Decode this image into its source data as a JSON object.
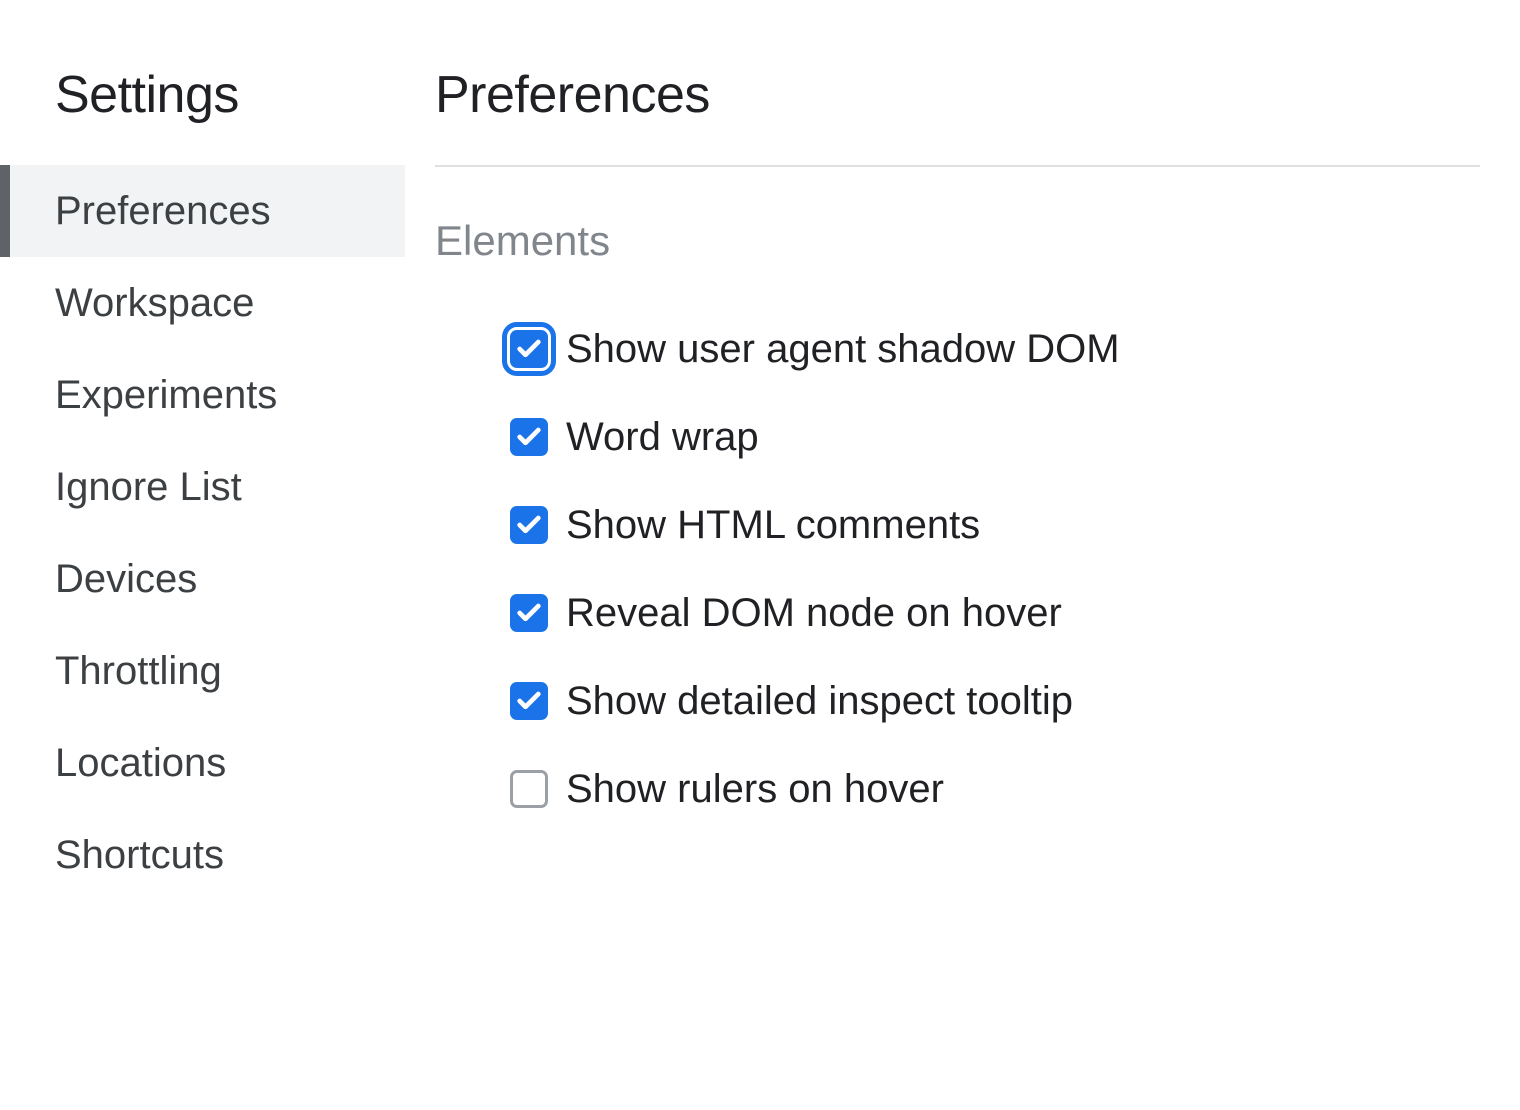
{
  "sidebar": {
    "title": "Settings",
    "items": [
      {
        "label": "Preferences",
        "active": true
      },
      {
        "label": "Workspace",
        "active": false
      },
      {
        "label": "Experiments",
        "active": false
      },
      {
        "label": "Ignore List",
        "active": false
      },
      {
        "label": "Devices",
        "active": false
      },
      {
        "label": "Throttling",
        "active": false
      },
      {
        "label": "Locations",
        "active": false
      },
      {
        "label": "Shortcuts",
        "active": false
      }
    ]
  },
  "main": {
    "title": "Preferences",
    "section": {
      "title": "Elements",
      "options": [
        {
          "label": "Show user agent shadow DOM",
          "checked": true,
          "focused": true
        },
        {
          "label": "Word wrap",
          "checked": true,
          "focused": false
        },
        {
          "label": "Show HTML comments",
          "checked": true,
          "focused": false
        },
        {
          "label": "Reveal DOM node on hover",
          "checked": true,
          "focused": false
        },
        {
          "label": "Show detailed inspect tooltip",
          "checked": true,
          "focused": false
        },
        {
          "label": "Show rulers on hover",
          "checked": false,
          "focused": false
        }
      ]
    }
  }
}
